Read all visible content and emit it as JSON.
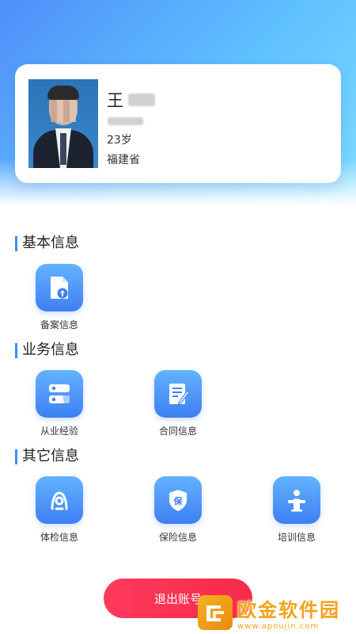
{
  "profile": {
    "name": "王",
    "age": "23岁",
    "province": "福建省"
  },
  "sections": {
    "basic": {
      "title": "基本信息",
      "items": [
        {
          "label": "备案信息",
          "icon": "document-upload-icon"
        }
      ]
    },
    "business": {
      "title": "业务信息",
      "items": [
        {
          "label": "从业经验",
          "icon": "experience-cards-icon"
        },
        {
          "label": "合同信息",
          "icon": "contract-edit-icon"
        }
      ]
    },
    "other": {
      "title": "其它信息",
      "items": [
        {
          "label": "体检信息",
          "icon": "health-check-icon"
        },
        {
          "label": "保险信息",
          "icon": "insurance-shield-icon"
        },
        {
          "label": "培训信息",
          "icon": "training-lectern-icon"
        }
      ]
    }
  },
  "logout_label": "退出账号",
  "watermark": {
    "title": "欧金软件园",
    "url": "www.apoujin.com"
  },
  "colors": {
    "accent": "#3a8ef6",
    "logout": "#f72a4a",
    "hero_start": "#4f8ff9",
    "hero_end": "#7fdcff"
  }
}
